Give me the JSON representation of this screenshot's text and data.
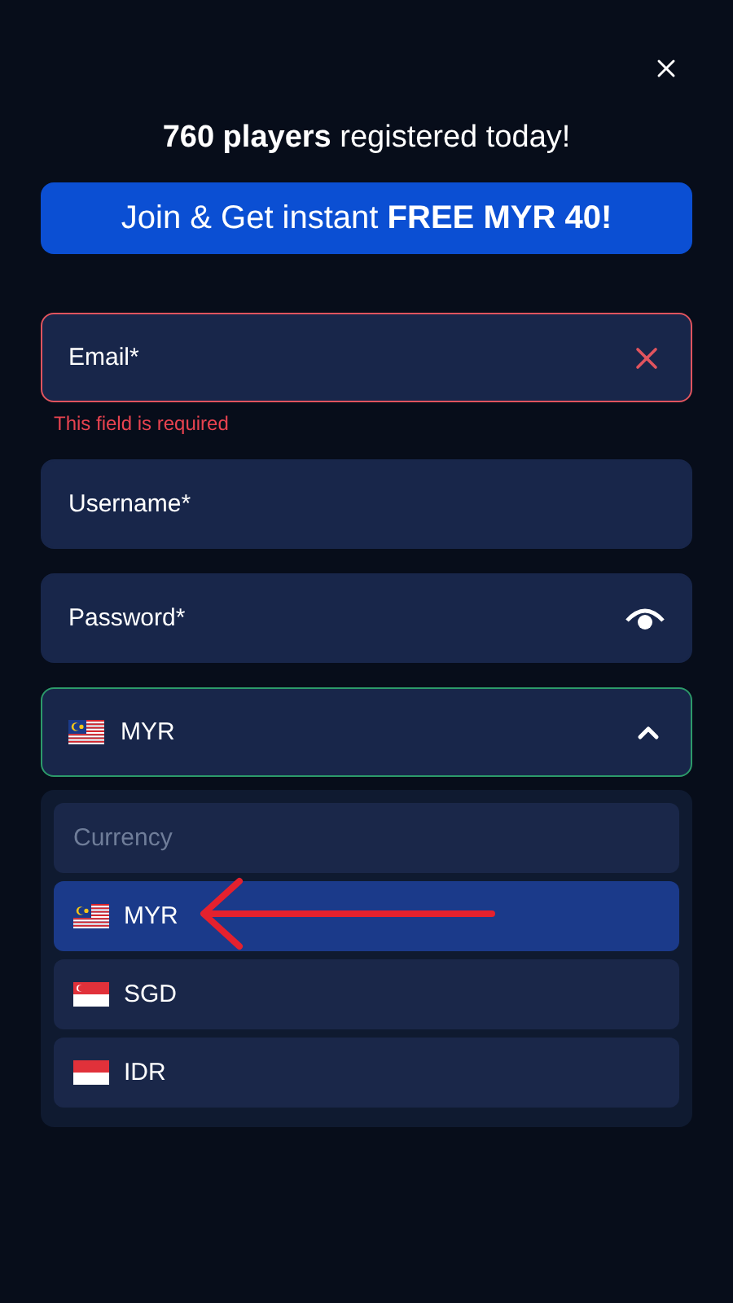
{
  "headline": "**760 players** registered today!",
  "banner": "Join & Get instant **FREE MYR 40!**",
  "fields": [
    {
      "placeholder": "Email*",
      "kind": "text",
      "invalid": true,
      "error": "This field is required"
    },
    {
      "placeholder": "Username*",
      "kind": "text",
      "invalid": false
    },
    {
      "placeholder": "Password*",
      "kind": "password",
      "invalid": false
    }
  ],
  "currency": {
    "value": "MYR",
    "kind": "my",
    "expanded": true,
    "placeholder": "Currency",
    "options": [
      {
        "label": "MYR",
        "kind": "my",
        "selected": true
      },
      {
        "label": "SGD",
        "kind": "sg",
        "selected": false
      },
      {
        "label": "IDR",
        "kind": "id",
        "selected": false
      }
    ]
  },
  "annotation": {
    "kind": "arrow"
  }
}
